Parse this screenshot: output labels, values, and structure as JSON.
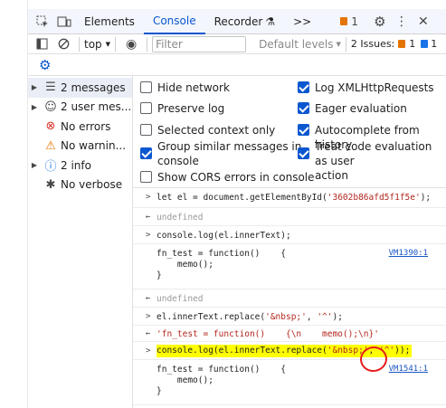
{
  "tabs": {
    "elements": "Elements",
    "console": "Console",
    "recorder": "Recorder",
    "more": ">>",
    "issues_count": "1"
  },
  "toolbar": {
    "context": "top",
    "filter_placeholder": "Filter",
    "levels": "Default levels",
    "issues_label": "2 Issues:",
    "issue_a": "1",
    "issue_b": "1"
  },
  "sidebar": {
    "items": [
      {
        "label": "2 messages"
      },
      {
        "label": "2 user mes..."
      },
      {
        "label": "No errors"
      },
      {
        "label": "No warnin..."
      },
      {
        "label": "2 info"
      },
      {
        "label": "No verbose"
      }
    ]
  },
  "settings": {
    "hide_network": "Hide network",
    "log_xhr": "Log XMLHttpRequests",
    "preserve_log": "Preserve log",
    "eager_eval": "Eager evaluation",
    "selected_context": "Selected context only",
    "autocomplete": "Autocomplete from history",
    "group_similar_1": "Group similar messages in",
    "group_similar_2": "console",
    "treat_eval_1": "Treat code evaluation as user",
    "treat_eval_2": "action",
    "cors_errors": "Show CORS errors in console"
  },
  "console": {
    "l1_a": "let el = document.getElementById(",
    "l1_b": "'3602b86afd5f1f5e'",
    "l1_c": ");",
    "r1": "undefined",
    "l2": "console.log(el.innerText);",
    "o2_a": "fn_test = function()    {",
    "o2_b": "    memo();",
    "o2_c": "}",
    "link2": "VM1390:1",
    "r2": "undefined",
    "l3_a": "el.innerText.replace(",
    "l3_b": "'&nbsp;'",
    "l3_c": ", ",
    "l3_d": "'^'",
    "l3_e": ");",
    "r3": "'fn_test = function()    {\\n    memo();\\n}'",
    "l4_a": "console.log(el.innerText.replace(",
    "l4_b": "'&nbsp;'",
    "l4_c": ", ",
    "l4_d": "'^'",
    "l4_e": "));",
    "o4_a": "fn_test = function()    {",
    "o4_b": "    memo();",
    "o4_c": "}",
    "link4": "VM1541:1"
  }
}
